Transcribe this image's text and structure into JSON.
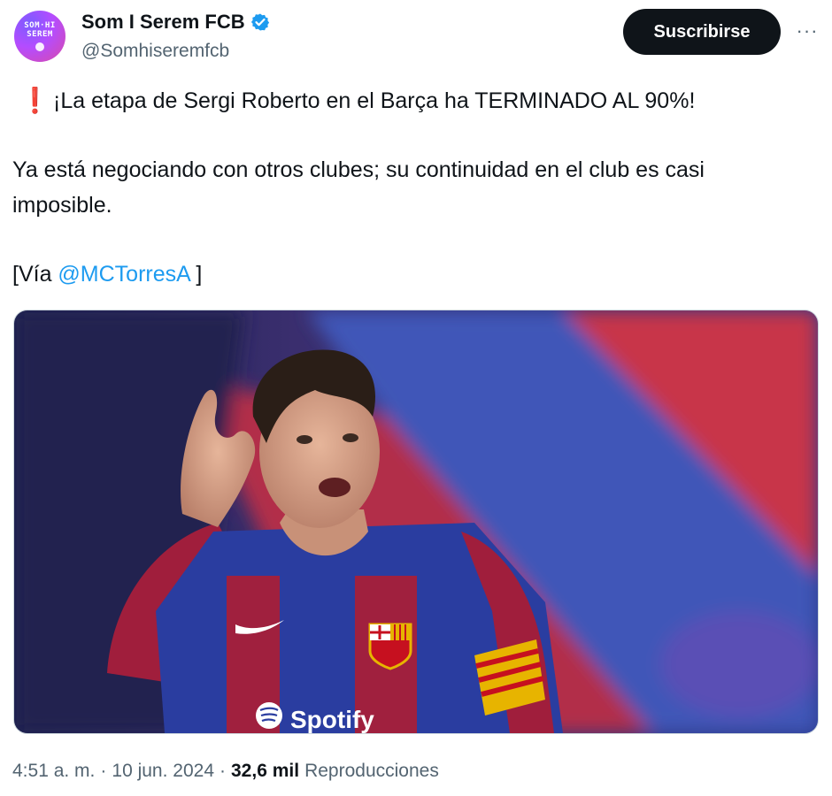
{
  "author": {
    "name": "Som I Serem FCB",
    "handle": "@Somhiseremfcb",
    "avatar_text_line1": "SOM·HI",
    "avatar_text_line2": "SEREM",
    "verified_icon": "verified-badge-icon",
    "verified_color": "#1d9bf0"
  },
  "actions": {
    "subscribe_label": "Suscribirse",
    "more_label": "···"
  },
  "tweet": {
    "line1_icon": "red-exclamation-icon",
    "line1_text": "¡La etapa de Sergi Roberto en el Barça ha TERMINADO AL 90%!",
    "line2_text": "Ya está negociando con otros clubes; su continuidad en el club es casi imposible.",
    "via_prefix": "[Vía ",
    "via_mention": "@MCTorresA",
    "via_suffix": " ]"
  },
  "media": {
    "description_icon": "photo-footballer",
    "jersey_sponsor": "Spotify"
  },
  "footer": {
    "time": "4:51 a. m.",
    "separator": "·",
    "date": "10 jun. 2024",
    "views_count": "32,6 mil",
    "views_label": "Reproducciones"
  },
  "colors": {
    "accent_link": "#1d9bf0",
    "button_bg": "#0f1419",
    "secondary_text": "#536471",
    "exclamation": "#e8222a"
  }
}
